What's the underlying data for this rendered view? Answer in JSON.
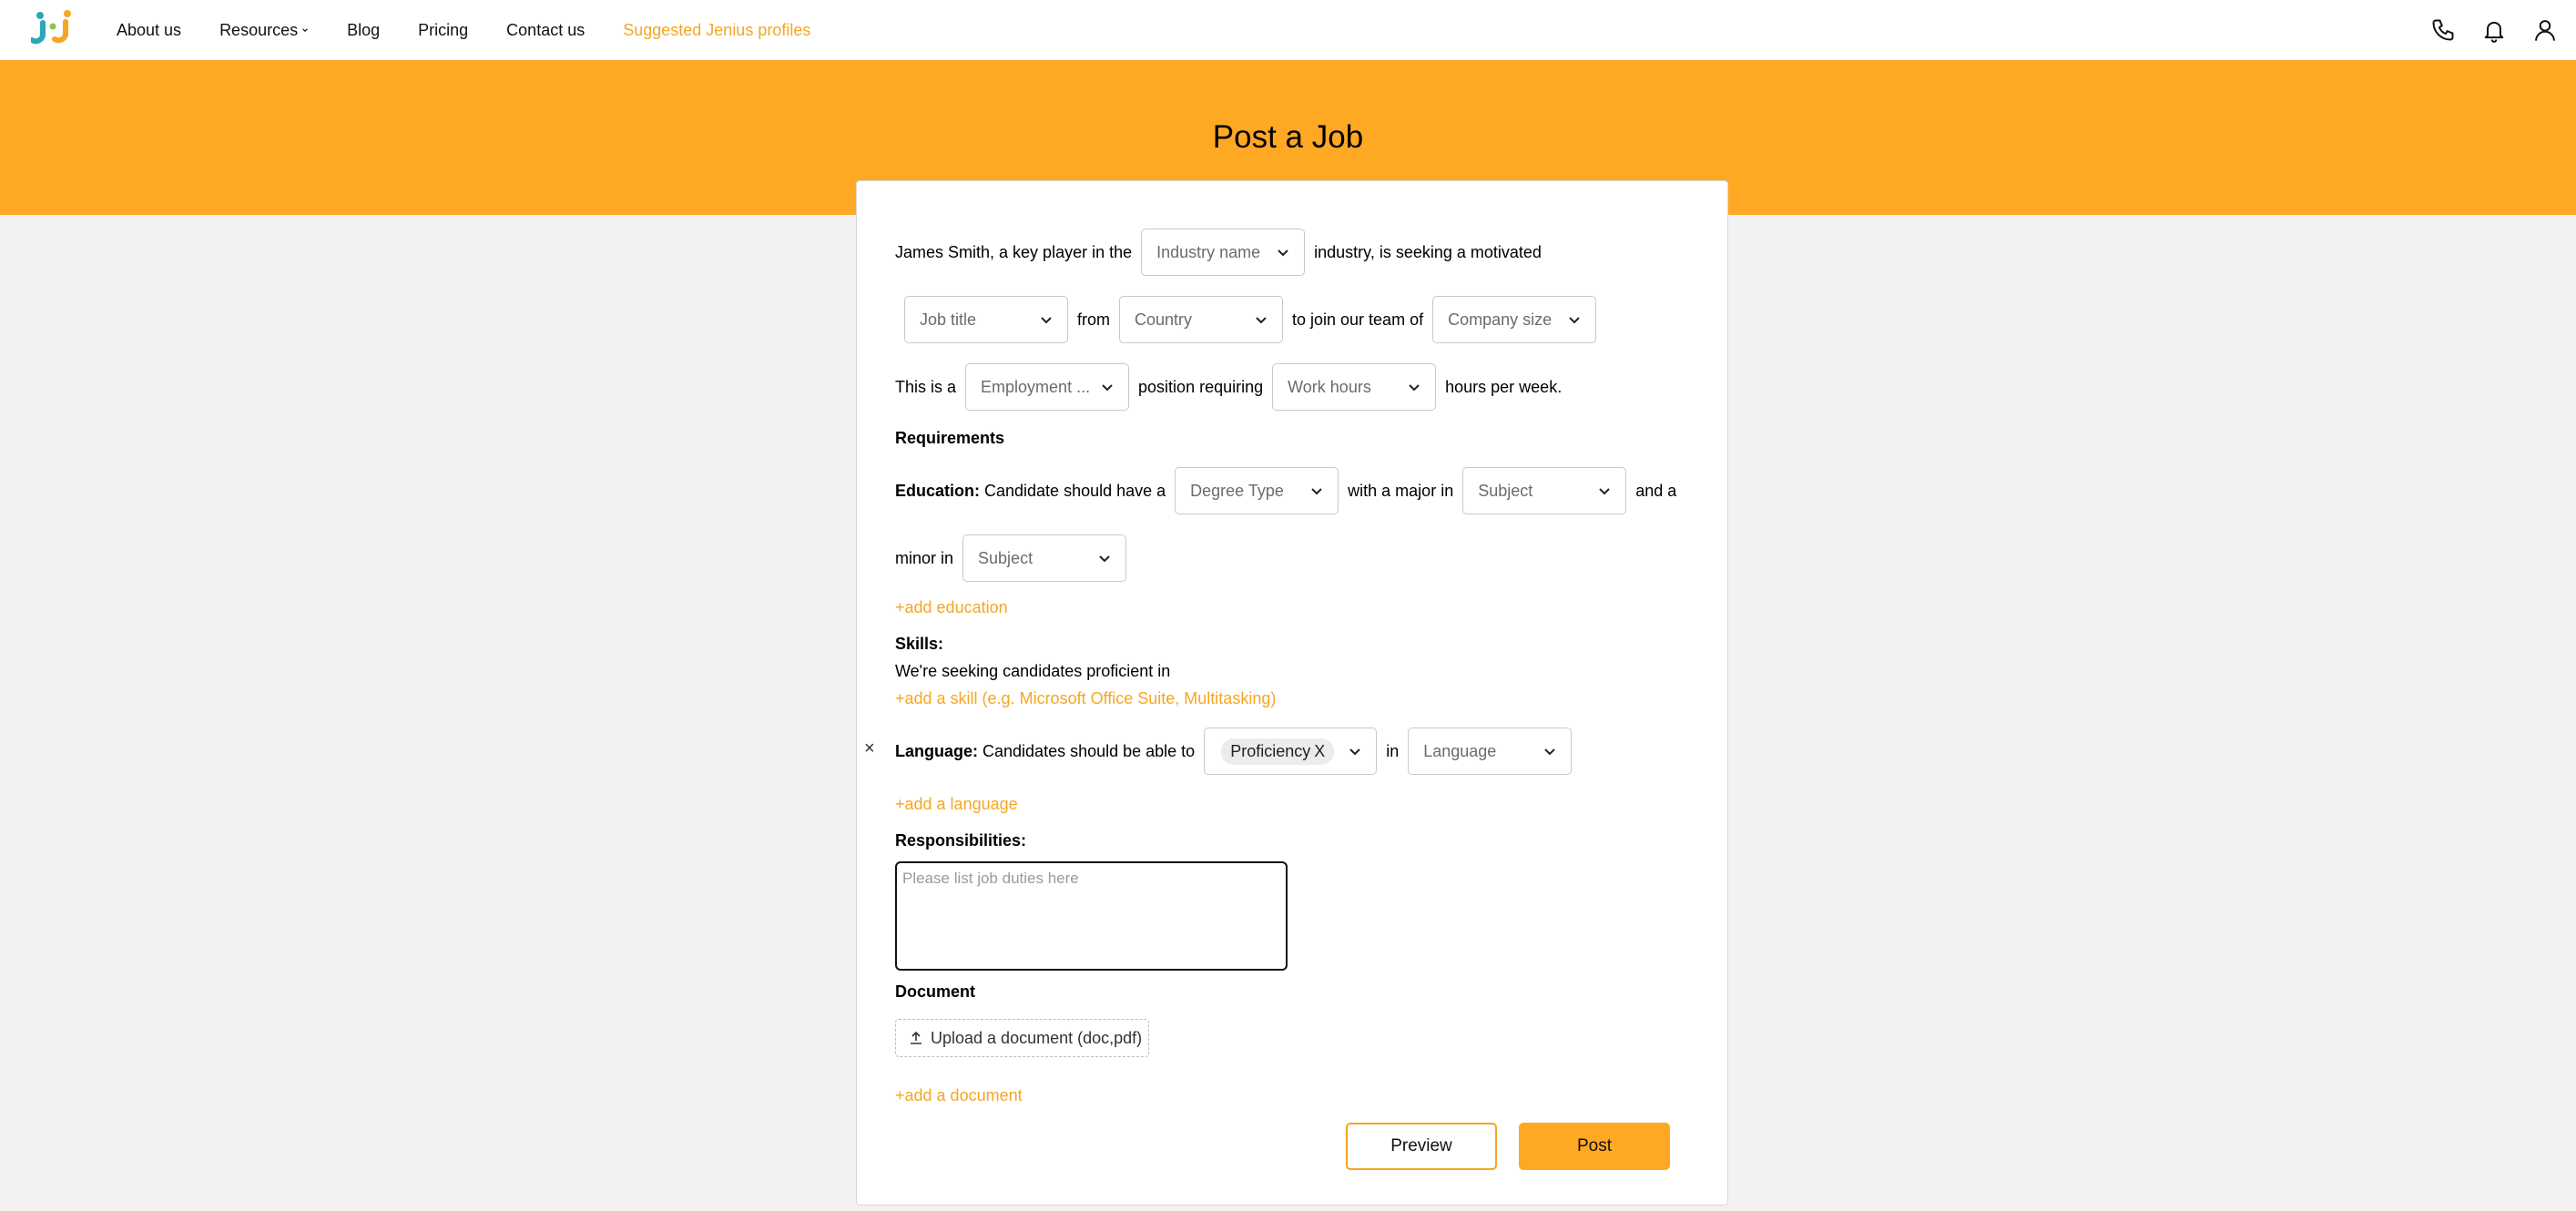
{
  "nav": {
    "items": [
      "About us",
      "Resources",
      "Blog",
      "Pricing",
      "Contact us",
      "Suggested Jenius profiles"
    ]
  },
  "colors": {
    "accent": "#fea824",
    "link": "#f5a623",
    "background": "#f2f2f2"
  },
  "icons": {
    "topbar": [
      "phone-icon",
      "bell-icon",
      "user-icon"
    ]
  },
  "page": {
    "title": "Post a Job"
  },
  "form": {
    "line1": {
      "prefix": "James Smith, a key player in the",
      "industry_placeholder": "Industry name",
      "suffix": "industry, is seeking a motivated"
    },
    "line2": {
      "job_title_placeholder": "Job title",
      "from": "from",
      "country_placeholder": "Country",
      "join": "to join our team of",
      "company_size_placeholder": "Company size"
    },
    "line3": {
      "prefix": "This is a",
      "employment_placeholder": "Employment ...",
      "middle": "position requiring",
      "work_hours_placeholder": "Work hours",
      "suffix": "hours per week."
    },
    "requirements_heading": "Requirements",
    "education": {
      "label": "Education:",
      "text1": "Candidate should have a",
      "degree_placeholder": "Degree Type",
      "text2": "with a major in",
      "major_placeholder": "Subject",
      "text3": "and a",
      "text4": "minor in",
      "minor_placeholder": "Subject",
      "add_link": "+add education"
    },
    "skills": {
      "label": "Skills:",
      "text": "We're seeking candidates proficient in",
      "add_link": "+add a skill (e.g. Microsoft Office Suite, Multitasking)"
    },
    "language": {
      "remove": "×",
      "label": "Language:",
      "text": "Candidates should be able to",
      "proficiency_chip": "Proficiency",
      "chip_remove": "X",
      "in": "in",
      "language_placeholder": "Language",
      "add_link": "+add a language"
    },
    "responsibilities": {
      "label": "Responsibilities:",
      "placeholder": "Please list job duties here"
    },
    "document": {
      "label": "Document",
      "upload_label": "Upload a document (doc,pdf)",
      "add_link": "+add a document"
    },
    "buttons": {
      "preview": "Preview",
      "post": "Post"
    }
  }
}
